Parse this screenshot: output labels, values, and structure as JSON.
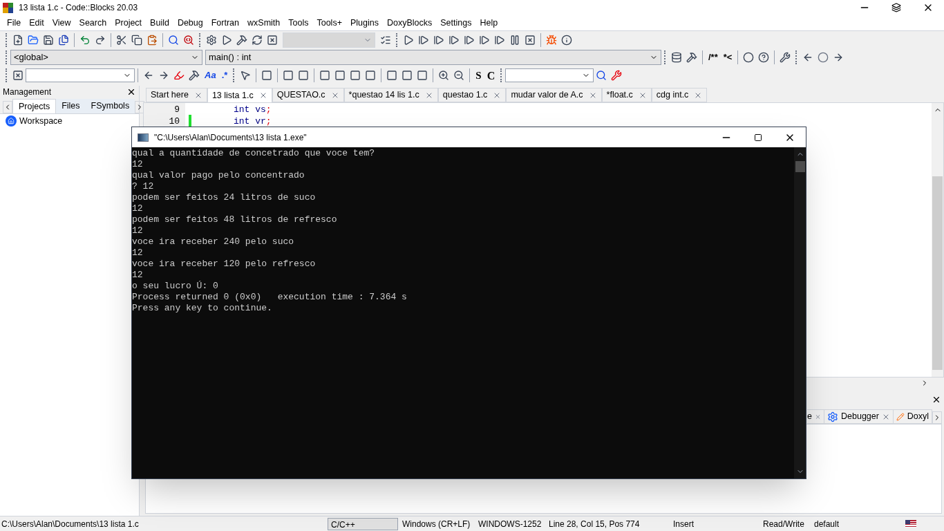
{
  "window": {
    "title": "13 lista 1.c - Code::Blocks 20.03"
  },
  "menu": [
    "File",
    "Edit",
    "View",
    "Search",
    "Project",
    "Build",
    "Debug",
    "Fortran",
    "wxSmith",
    "Tools",
    "Tools+",
    "Plugins",
    "DoxyBlocks",
    "Settings",
    "Help"
  ],
  "toolbar_text": {
    "doc_block": "/**",
    "doc_line": "*<",
    "match_case": "Aa",
    "regex": ".*",
    "strings": "S",
    "chars": "C"
  },
  "scope_select": {
    "value": "<global>"
  },
  "function_select": {
    "value": "main() : int"
  },
  "management": {
    "title": "Management",
    "tabs": [
      {
        "label": "Projects",
        "selected": true
      },
      {
        "label": "Files",
        "selected": false
      },
      {
        "label": "FSymbols",
        "selected": false
      }
    ],
    "tree": [
      "Workspace"
    ]
  },
  "editor_tabs": [
    {
      "label": "Start here",
      "selected": false
    },
    {
      "label": "13 lista 1.c",
      "selected": true
    },
    {
      "label": "QUESTAO.c",
      "selected": false
    },
    {
      "label": "*questao 14 lis 1.c",
      "selected": false
    },
    {
      "label": "questao 1.c",
      "selected": false
    },
    {
      "label": "mudar valor de A.c",
      "selected": false
    },
    {
      "label": "*float.c",
      "selected": false
    },
    {
      "label": "cdg int.c",
      "selected": false
    }
  ],
  "code_lines": [
    {
      "number": "9",
      "changed": false,
      "tokens": [
        {
          "kind": "keyword",
          "text": "int"
        },
        {
          "kind": "plain",
          "text": " vs"
        },
        {
          "kind": "punct",
          "text": ";"
        }
      ]
    },
    {
      "number": "10",
      "changed": true,
      "tokens": [
        {
          "kind": "keyword",
          "text": "int"
        },
        {
          "kind": "plain",
          "text": " vr"
        },
        {
          "kind": "punct",
          "text": ";"
        }
      ]
    }
  ],
  "logs_panel": {
    "tabs": [
      {
        "label": "e",
        "kind": "plain",
        "selected": false
      },
      {
        "label": "Debugger",
        "kind": "debugger",
        "selected": false
      },
      {
        "label": "Doxyl",
        "kind": "doxygen",
        "selected": false
      }
    ]
  },
  "console": {
    "title": "\"C:\\Users\\Alan\\Documents\\13 lista 1.exe\"",
    "lines": [
      "qual a quantidade de concetrado que voce tem?",
      "12",
      "qual valor pago pelo concentrado",
      "? 12",
      "podem ser feitos 24 litros de suco",
      "12",
      "podem ser feitos 48 litros de refresco",
      "12",
      "voce ira receber 240 pelo suco",
      "12",
      "voce ira receber 120 pelo refresco",
      "12",
      "o seu lucro Ú: 0",
      "Process returned 0 (0x0)   execution time : 7.364 s",
      "Press any key to continue."
    ]
  },
  "status_bar": {
    "path": "C:\\Users\\Alan\\Documents\\13 lista 1.c",
    "language": "C/C++",
    "eol": "Windows (CR+LF)",
    "encoding": "WINDOWS-1252",
    "position": "Line 28, Col 15, Pos 774",
    "mode": "Insert",
    "access": "Read/Write",
    "profile": "default"
  }
}
